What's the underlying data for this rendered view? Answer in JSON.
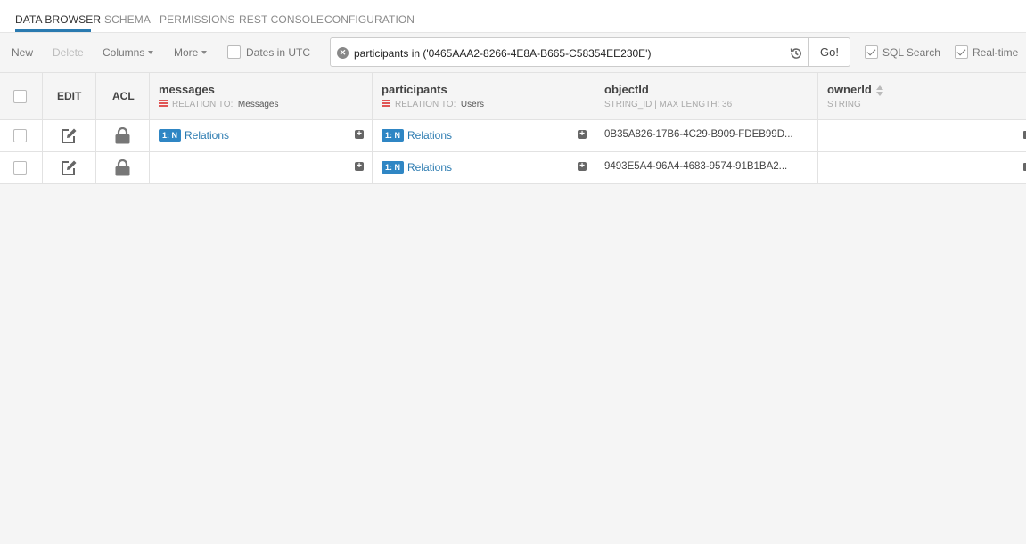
{
  "tabs": [
    "DATA BROWSER",
    "SCHEMA",
    "PERMISSIONS",
    "REST CONSOLE",
    "CONFIGURATION"
  ],
  "toolbar": {
    "new_label": "New",
    "delete_label": "Delete",
    "columns_label": "Columns",
    "more_label": "More",
    "dates_utc_label": "Dates in UTC",
    "go_label": "Go!",
    "sql_search_label": "SQL Search",
    "realtime_label": "Real-time"
  },
  "search": {
    "query": "participants in ('0465AAA2-8266-4E8A-B665-C58354EE230E')"
  },
  "columns": {
    "edit": "EDIT",
    "acl": "ACL",
    "messages": {
      "name": "messages",
      "subtitle": "RELATION TO:",
      "target": "Messages"
    },
    "participants": {
      "name": "participants",
      "subtitle": "RELATION TO:",
      "target": "Users"
    },
    "objectId": {
      "name": "objectId",
      "subtitle": "STRING_ID | MAX LENGTH: 36"
    },
    "ownerId": {
      "name": "ownerId",
      "subtitle": "STRING"
    }
  },
  "rows": [
    {
      "messages_badge": "1: N",
      "messages_link": "Relations",
      "participants_badge": "1: N",
      "participants_link": "Relations",
      "objectId": "0B35A826-17B6-4C29-B909-FDEB99D..."
    },
    {
      "participants_badge": "1: N",
      "participants_link": "Relations",
      "objectId": "9493E5A4-96A4-4683-9574-91B1BA2..."
    }
  ],
  "icons": {
    "clear": "close-circle-icon",
    "history": "history-icon",
    "edit": "edit-icon",
    "lock": "lock-icon",
    "plus": "plus-square-icon"
  },
  "colors": {
    "accent": "#2a7ab0",
    "badge": "#2f86c4",
    "relation_marker": "#e05555"
  }
}
